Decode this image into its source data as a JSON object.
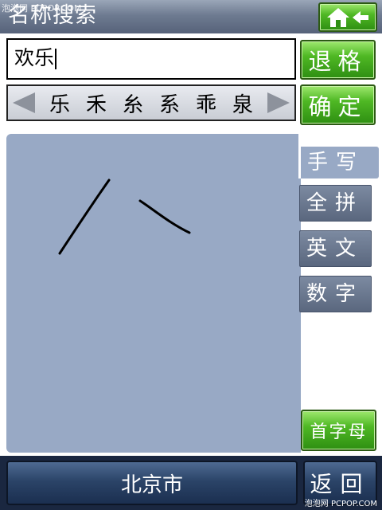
{
  "header": {
    "title": "名称搜索",
    "watermark": "泡泡网 PCPOP.COM"
  },
  "search": {
    "value": "欢乐"
  },
  "candidates": [
    "乐",
    "禾",
    "糸",
    "系",
    "乖",
    "泉"
  ],
  "buttons": {
    "backspace": "退格",
    "confirm": "确定",
    "initials": "首字母"
  },
  "input_modes": {
    "active": "手写",
    "pinyin": "全拼",
    "english": "英文",
    "digits": "数字"
  },
  "bottom": {
    "city": "北京市",
    "back": "返回",
    "footer_watermark": "泡泡网 PCPOP.COM"
  },
  "colors": {
    "accent_green": "#4fb824",
    "pad": "#98a9c5",
    "title_bar": "#6e7b91",
    "bottom_bar": "#1a2740"
  }
}
